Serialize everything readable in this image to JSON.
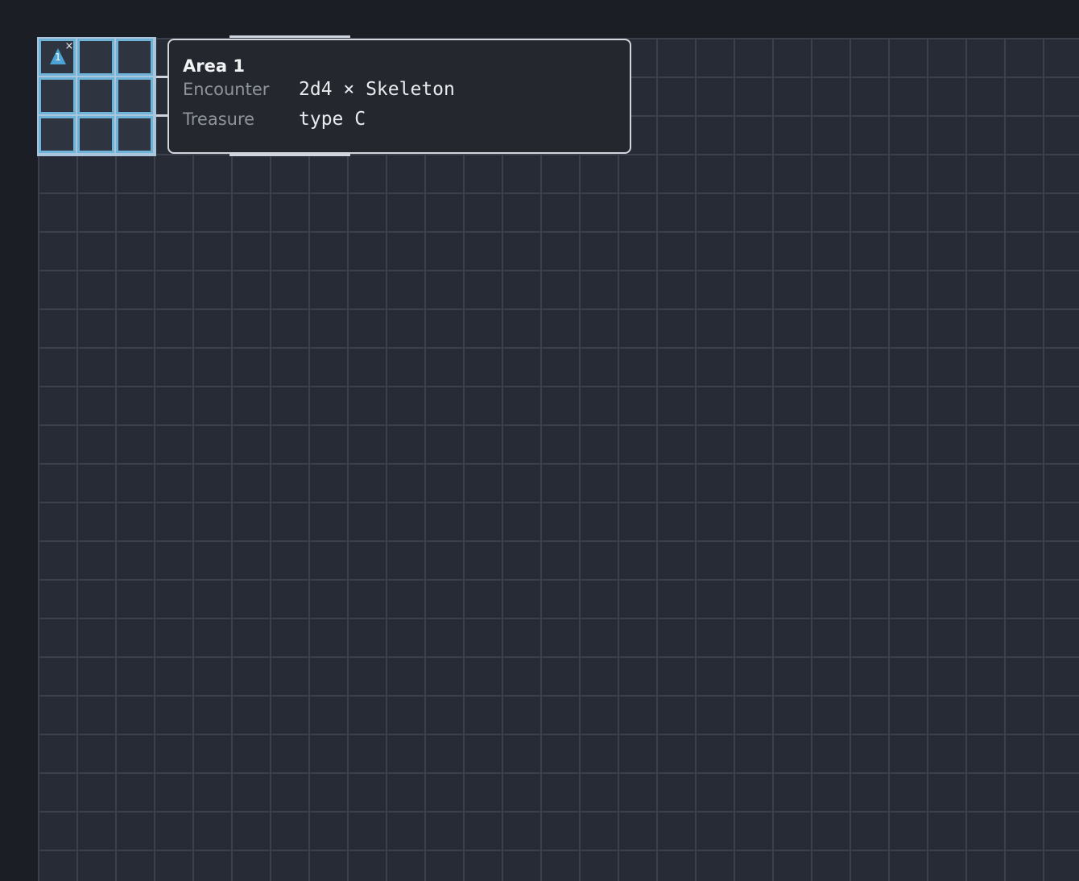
{
  "area": {
    "marker_icon": "triangle-marker-icon",
    "marker_label": "1",
    "close_label": "×",
    "highlight_color": "#6fb3d9"
  },
  "tooltip": {
    "title": "Area 1",
    "rows": [
      {
        "label": "Encounter",
        "value": "2d4 × Skeleton"
      },
      {
        "label": "Treasure",
        "value": "type C"
      }
    ]
  },
  "colors": {
    "background": "#1b1e25",
    "grid_fill": "#272b35",
    "grid_line": "#3b404c",
    "wall": "#cfd5dd"
  }
}
